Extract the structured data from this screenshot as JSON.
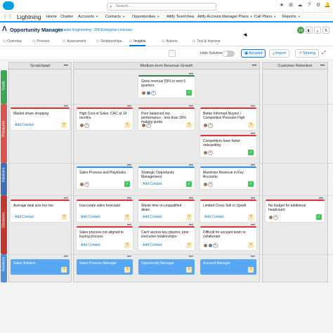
{
  "app": {
    "name": "Lightning",
    "search_placeholder": "Search..."
  },
  "nav": [
    {
      "label": "Home"
    },
    {
      "label": "Chatter"
    },
    {
      "label": "Accounts"
    },
    {
      "label": "Contacts"
    },
    {
      "label": "Opportunities"
    },
    {
      "label": "Altify TeamView"
    },
    {
      "label": "Altify Account Manager Plans"
    },
    {
      "label": "Call Plans"
    },
    {
      "label": "Reports"
    }
  ],
  "header": {
    "title": "Opportunity Manager",
    "subtitle": "Ancaster Engineering - 200 Enterprise Licenses",
    "badge": "14"
  },
  "tabs": [
    {
      "label": "Overview"
    },
    {
      "label": "Process"
    },
    {
      "label": "Assessment"
    },
    {
      "label": "Relationships"
    },
    {
      "label": "Insights"
    },
    {
      "label": "Actions"
    },
    {
      "label": "Test & Improve"
    }
  ],
  "toolbar": {
    "hide_solutions": "Hide Solutions",
    "account": "Account",
    "import": "Import",
    "sharing": "Sharing"
  },
  "columns": [
    {
      "title": "Scratchpad"
    },
    {
      "title": "Medium-term Revenue Growth"
    },
    {
      "title": "Customer Retention"
    }
  ],
  "rows": [
    {
      "label": "Goals",
      "color": "#3ba755"
    },
    {
      "label": "Pressures",
      "color": "#d9534f"
    },
    {
      "label": "Initiatives",
      "color": "#3f6fb5"
    },
    {
      "label": "Obstacles",
      "color": "#c23934"
    },
    {
      "label": "Solutions",
      "color": "#4a90d9"
    }
  ],
  "cards": {
    "grow_revenue": "Grow revenue 55% in next 6 quarters",
    "market_share": "Market share dropping",
    "high_cost": "High Cost of Sales: CAC at 14 months",
    "poor_rep": "Poor balanced rep performance - less than 30% making quota",
    "better_buyers": "Better Informed Buyers / Competitive Pressure High",
    "competitors": "Competitors have faster onboarding",
    "sales_process": "Sales Process and Playbooks",
    "strategic_opp": "Strategic Opportunity Management",
    "maximize_rev": "Maximize Revenue in Key Accounts",
    "avg_deal": "Average deal size too low",
    "inaccurate": "Inaccurate sales forecasts",
    "wasted_time": "Waste time on unqualified deals",
    "limited_cross": "Limited Cross Sell or Upsell",
    "no_budget": "No budget for additional headcount",
    "not_aligned": "Sales process not aligned to buying process",
    "cant_access": "Can't access key players, poor executive relationships",
    "difficult": "Difficult for account team to collaborate",
    "add_contact": "Add Contact"
  },
  "solutions": [
    {
      "label": "Sales Solution"
    },
    {
      "label": "Sales Process Manager"
    },
    {
      "label": "Opportunity Manager"
    },
    {
      "label": "Account Manager"
    }
  ]
}
